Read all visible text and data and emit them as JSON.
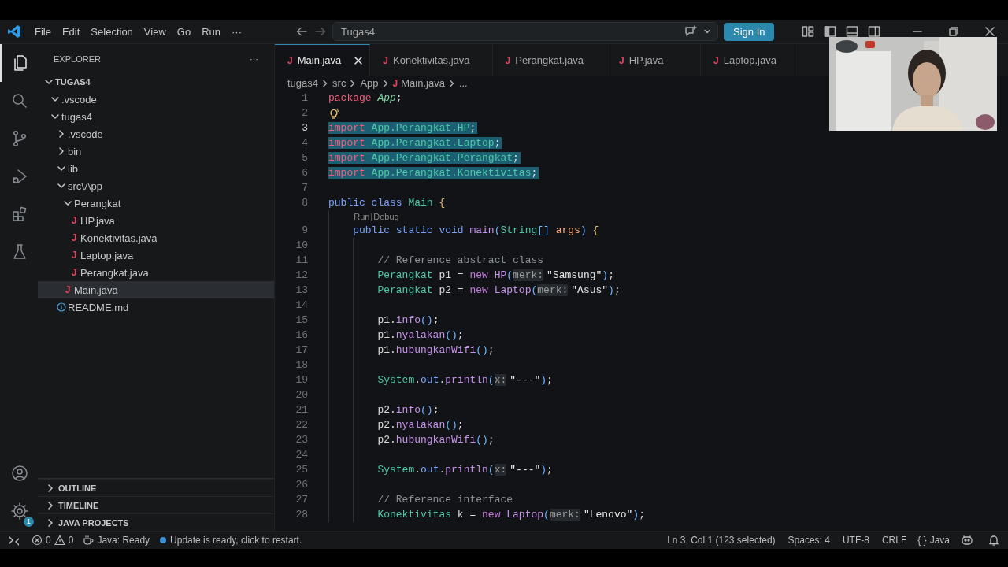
{
  "title_bar": {
    "menu": [
      "File",
      "Edit",
      "Selection",
      "View",
      "Go",
      "Run"
    ],
    "more": "···",
    "command_center": {
      "value": "Tugas4"
    },
    "sign_in": "Sign In"
  },
  "activity_bar": {
    "items": [
      {
        "kind": "explorer",
        "selected": true
      },
      {
        "kind": "search",
        "selected": false
      },
      {
        "kind": "scm",
        "selected": false
      },
      {
        "kind": "debug",
        "selected": false
      },
      {
        "kind": "extensions",
        "selected": false
      },
      {
        "kind": "testing",
        "selected": false
      }
    ],
    "bottom": [
      {
        "kind": "account"
      },
      {
        "kind": "settings",
        "badge": "1"
      }
    ]
  },
  "sidebar": {
    "title": "EXPLORER",
    "more": "···",
    "tree": [
      {
        "label": "TUGAS4",
        "kind": "root",
        "expanded": true,
        "selected": false,
        "children": [
          {
            "label": ".vscode",
            "kind": "folder",
            "expanded": true,
            "selected": false
          },
          {
            "label": "tugas4",
            "kind": "folder",
            "expanded": true,
            "selected": false,
            "children": [
              {
                "label": ".vscode",
                "kind": "folder",
                "expanded": false,
                "selected": false
              },
              {
                "label": "bin",
                "kind": "folder",
                "expanded": false,
                "selected": false
              },
              {
                "label": "lib",
                "kind": "folder",
                "expanded": true,
                "selected": false
              },
              {
                "label": "src\\App",
                "kind": "folder",
                "expanded": true,
                "selected": false,
                "children": [
                  {
                    "label": "Perangkat",
                    "kind": "folder",
                    "expanded": true,
                    "selected": false,
                    "children": [
                      {
                        "label": "HP.java",
                        "kind": "java",
                        "badge": "J",
                        "selected": false
                      },
                      {
                        "label": "Konektivitas.java",
                        "kind": "java",
                        "badge": "J",
                        "selected": false
                      },
                      {
                        "label": "Laptop.java",
                        "kind": "java",
                        "badge": "J",
                        "selected": false
                      },
                      {
                        "label": "Perangkat.java",
                        "kind": "java",
                        "badge": "J",
                        "selected": false
                      }
                    ]
                  },
                  {
                    "label": "Main.java",
                    "kind": "java",
                    "badge": "J",
                    "selected": true
                  }
                ]
              },
              {
                "label": "README.md",
                "kind": "info",
                "selected": false
              }
            ]
          }
        ]
      }
    ],
    "sections": [
      {
        "label": "OUTLINE",
        "expanded": false
      },
      {
        "label": "TIMELINE",
        "expanded": false
      },
      {
        "label": "JAVA PROJECTS",
        "expanded": false
      }
    ]
  },
  "tabs": [
    {
      "label": "Main.java",
      "badge": "J",
      "selected": true
    },
    {
      "label": "Konektivitas.java",
      "badge": "J",
      "selected": false
    },
    {
      "label": "Perangkat.java",
      "badge": "J",
      "selected": false
    },
    {
      "label": "HP.java",
      "badge": "J",
      "selected": false
    },
    {
      "label": "Laptop.java",
      "badge": "J",
      "selected": false
    }
  ],
  "breadcrumb": [
    {
      "label": "tugas4"
    },
    {
      "label": "src"
    },
    {
      "label": "App"
    },
    {
      "label": "Main.java",
      "badge": "J"
    },
    {
      "label": "..."
    }
  ],
  "editor": {
    "lines": [
      {
        "n": "1",
        "current": false,
        "selected": false,
        "tokens": [
          {
            "kind": "kw",
            "text": "package"
          },
          {
            "kind": "ns",
            "text": " App"
          },
          {
            "kind": "plain",
            "text": ";"
          }
        ]
      },
      {
        "n": "2",
        "current": false,
        "selected": false,
        "lightbulb": true
      },
      {
        "n": "3",
        "current": true,
        "selected": true,
        "tokens": [
          {
            "kind": "kw",
            "text": "import"
          },
          {
            "kind": "type",
            "text": " App.Perangkat.HP"
          },
          {
            "kind": "plain",
            "text": ";"
          }
        ]
      },
      {
        "n": "4",
        "current": false,
        "selected": true,
        "tokens": [
          {
            "kind": "kw",
            "text": "import"
          },
          {
            "kind": "type",
            "text": " App.Perangkat.Laptop"
          },
          {
            "kind": "plain",
            "text": ";"
          }
        ]
      },
      {
        "n": "5",
        "current": false,
        "selected": true,
        "tokens": [
          {
            "kind": "kw",
            "text": "import"
          },
          {
            "kind": "type",
            "text": " App.Perangkat.Perangkat"
          },
          {
            "kind": "plain",
            "text": ";"
          }
        ]
      },
      {
        "n": "6",
        "current": false,
        "selected": true,
        "tokens": [
          {
            "kind": "kw",
            "text": "import"
          },
          {
            "kind": "type",
            "text": " App.Perangkat.Konektivitas"
          },
          {
            "kind": "plain",
            "text": ";"
          }
        ]
      },
      {
        "n": "7",
        "current": false,
        "selected": false
      },
      {
        "n": "8",
        "current": false,
        "selected": false,
        "tokens": [
          {
            "kind": "kwb",
            "text": "public"
          },
          {
            "kind": "kwb",
            "text": " class"
          },
          {
            "kind": "type",
            "text": " Main"
          },
          {
            "kind": "brace",
            "text": " {"
          }
        ],
        "codelens": {
          "items": [
            "Run",
            "Debug"
          ],
          "separator": "|"
        },
        "children": [
          {
            "n": "9",
            "current": false,
            "selected": false,
            "tokens": [
              {
                "kind": "kwb",
                "text": "public"
              },
              {
                "kind": "kwb",
                "text": " static"
              },
              {
                "kind": "kwb",
                "text": " void"
              },
              {
                "kind": "fn",
                "text": " main"
              },
              {
                "kind": "paren",
                "text": "("
              },
              {
                "kind": "type",
                "text": "String"
              },
              {
                "kind": "paren",
                "text": "[]"
              },
              {
                "kind": "param",
                "text": " args"
              },
              {
                "kind": "paren",
                "text": ")"
              },
              {
                "kind": "brace",
                "text": " {"
              }
            ],
            "children": [
              {
                "n": "10",
                "current": false,
                "selected": false
              },
              {
                "n": "11",
                "current": false,
                "selected": false,
                "tokens": [
                  {
                    "kind": "comment",
                    "text": "// Reference abstract class"
                  }
                ]
              },
              {
                "n": "12",
                "current": false,
                "selected": false,
                "tokens": [
                  {
                    "kind": "type",
                    "text": "Perangkat"
                  },
                  {
                    "kind": "plain",
                    "text": " p1 ="
                  },
                  {
                    "kind": "kwp",
                    "text": " new"
                  },
                  {
                    "kind": "fn",
                    "text": " HP"
                  },
                  {
                    "kind": "paren",
                    "text": "("
                  },
                  {
                    "kind": "hint",
                    "text": "merk:"
                  },
                  {
                    "kind": "str",
                    "text": "\"Samsung\""
                  },
                  {
                    "kind": "paren",
                    "text": ")"
                  },
                  {
                    "kind": "plain",
                    "text": ";"
                  }
                ]
              },
              {
                "n": "13",
                "current": false,
                "selected": false,
                "tokens": [
                  {
                    "kind": "type",
                    "text": "Perangkat"
                  },
                  {
                    "kind": "plain",
                    "text": " p2 ="
                  },
                  {
                    "kind": "kwp",
                    "text": " new"
                  },
                  {
                    "kind": "fn",
                    "text": " Laptop"
                  },
                  {
                    "kind": "paren",
                    "text": "("
                  },
                  {
                    "kind": "hint",
                    "text": "merk:"
                  },
                  {
                    "kind": "str",
                    "text": "\"Asus\""
                  },
                  {
                    "kind": "paren",
                    "text": ")"
                  },
                  {
                    "kind": "plain",
                    "text": ";"
                  }
                ]
              },
              {
                "n": "14",
                "current": false,
                "selected": false
              },
              {
                "n": "15",
                "current": false,
                "selected": false,
                "tokens": [
                  {
                    "kind": "plain",
                    "text": "p1."
                  },
                  {
                    "kind": "fn",
                    "text": "info"
                  },
                  {
                    "kind": "paren",
                    "text": "()"
                  },
                  {
                    "kind": "plain",
                    "text": ";"
                  }
                ]
              },
              {
                "n": "16",
                "current": false,
                "selected": false,
                "tokens": [
                  {
                    "kind": "plain",
                    "text": "p1."
                  },
                  {
                    "kind": "fn",
                    "text": "nyalakan"
                  },
                  {
                    "kind": "paren",
                    "text": "()"
                  },
                  {
                    "kind": "plain",
                    "text": ";"
                  }
                ]
              },
              {
                "n": "17",
                "current": false,
                "selected": false,
                "tokens": [
                  {
                    "kind": "plain",
                    "text": "p1."
                  },
                  {
                    "kind": "fn",
                    "text": "hubungkanWifi"
                  },
                  {
                    "kind": "paren",
                    "text": "()"
                  },
                  {
                    "kind": "plain",
                    "text": ";"
                  }
                ]
              },
              {
                "n": "18",
                "current": false,
                "selected": false
              },
              {
                "n": "19",
                "current": false,
                "selected": false,
                "tokens": [
                  {
                    "kind": "type",
                    "text": "System"
                  },
                  {
                    "kind": "plain",
                    "text": "."
                  },
                  {
                    "kind": "field",
                    "text": "out"
                  },
                  {
                    "kind": "plain",
                    "text": "."
                  },
                  {
                    "kind": "fn",
                    "text": "println"
                  },
                  {
                    "kind": "paren",
                    "text": "("
                  },
                  {
                    "kind": "hint",
                    "text": "x:"
                  },
                  {
                    "kind": "str",
                    "text": "\"---\""
                  },
                  {
                    "kind": "paren",
                    "text": ")"
                  },
                  {
                    "kind": "plain",
                    "text": ";"
                  }
                ]
              },
              {
                "n": "20",
                "current": false,
                "selected": false
              },
              {
                "n": "21",
                "current": false,
                "selected": false,
                "tokens": [
                  {
                    "kind": "plain",
                    "text": "p2."
                  },
                  {
                    "kind": "fn",
                    "text": "info"
                  },
                  {
                    "kind": "paren",
                    "text": "()"
                  },
                  {
                    "kind": "plain",
                    "text": ";"
                  }
                ]
              },
              {
                "n": "22",
                "current": false,
                "selected": false,
                "tokens": [
                  {
                    "kind": "plain",
                    "text": "p2."
                  },
                  {
                    "kind": "fn",
                    "text": "nyalakan"
                  },
                  {
                    "kind": "paren",
                    "text": "()"
                  },
                  {
                    "kind": "plain",
                    "text": ";"
                  }
                ]
              },
              {
                "n": "23",
                "current": false,
                "selected": false,
                "tokens": [
                  {
                    "kind": "plain",
                    "text": "p2."
                  },
                  {
                    "kind": "fn",
                    "text": "hubungkanWifi"
                  },
                  {
                    "kind": "paren",
                    "text": "()"
                  },
                  {
                    "kind": "plain",
                    "text": ";"
                  }
                ]
              },
              {
                "n": "24",
                "current": false,
                "selected": false
              },
              {
                "n": "25",
                "current": false,
                "selected": false,
                "tokens": [
                  {
                    "kind": "type",
                    "text": "System"
                  },
                  {
                    "kind": "plain",
                    "text": "."
                  },
                  {
                    "kind": "field",
                    "text": "out"
                  },
                  {
                    "kind": "plain",
                    "text": "."
                  },
                  {
                    "kind": "fn",
                    "text": "println"
                  },
                  {
                    "kind": "paren",
                    "text": "("
                  },
                  {
                    "kind": "hint",
                    "text": "x:"
                  },
                  {
                    "kind": "str",
                    "text": "\"---\""
                  },
                  {
                    "kind": "paren",
                    "text": ")"
                  },
                  {
                    "kind": "plain",
                    "text": ";"
                  }
                ]
              },
              {
                "n": "26",
                "current": false,
                "selected": false
              },
              {
                "n": "27",
                "current": false,
                "selected": false,
                "tokens": [
                  {
                    "kind": "comment",
                    "text": "// Reference interface"
                  }
                ]
              },
              {
                "n": "28",
                "current": false,
                "selected": false,
                "tokens": [
                  {
                    "kind": "type",
                    "text": "Konektivitas"
                  },
                  {
                    "kind": "plain",
                    "text": " k ="
                  },
                  {
                    "kind": "kwp",
                    "text": " new"
                  },
                  {
                    "kind": "fn",
                    "text": " Laptop"
                  },
                  {
                    "kind": "paren",
                    "text": "("
                  },
                  {
                    "kind": "hint",
                    "text": "merk:"
                  },
                  {
                    "kind": "str",
                    "text": "\"Lenovo\""
                  },
                  {
                    "kind": "paren",
                    "text": ")"
                  },
                  {
                    "kind": "plain",
                    "text": ";"
                  }
                ]
              }
            ]
          }
        ]
      }
    ]
  },
  "status_bar": {
    "left": [
      {
        "kind": "remote"
      },
      {
        "kind": "problems",
        "errors": "0",
        "warnings": "0"
      },
      {
        "kind": "java",
        "label": "Java: Ready"
      },
      {
        "kind": "update",
        "label": "Update is ready, click to restart."
      }
    ],
    "right": [
      {
        "kind": "text",
        "label": "Ln 3, Col 1 (123 selected)"
      },
      {
        "kind": "text",
        "label": "Spaces: 4"
      },
      {
        "kind": "text",
        "label": "UTF-8"
      },
      {
        "kind": "text",
        "label": "CRLF"
      },
      {
        "kind": "language",
        "icon": "{ }",
        "label": "Java"
      },
      {
        "kind": "copilot"
      },
      {
        "kind": "bell"
      }
    ]
  }
}
